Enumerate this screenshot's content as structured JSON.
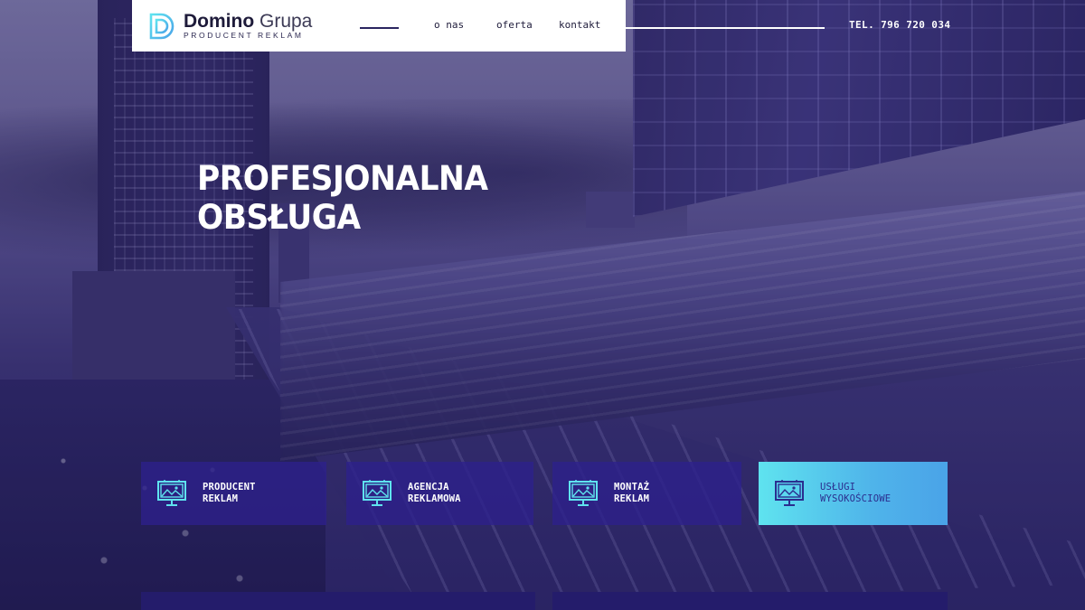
{
  "brand": {
    "name_bold": "Domino",
    "name_light": "Grupa",
    "tagline": "PRODUCENT REKLAM"
  },
  "nav": {
    "items": [
      {
        "label": "o nas"
      },
      {
        "label": "oferta"
      },
      {
        "label": "kontakt"
      }
    ]
  },
  "header": {
    "phone": "TEL. 796 720 034"
  },
  "hero": {
    "title_line1": "PROFESJONALNA",
    "title_line2": "OBSŁUGA"
  },
  "services": [
    {
      "line1": "PRODUCENT",
      "line2": "REKLAM",
      "icon": "billboard-icon"
    },
    {
      "line1": "AGENCJA",
      "line2": "REKLAMOWA",
      "icon": "billboard-icon"
    },
    {
      "line1": "MONTAŻ",
      "line2": "REKLAM",
      "icon": "billboard-icon"
    },
    {
      "line1": "USŁUGI",
      "line2": "WYSOKOŚCIOWE",
      "icon": "billboard-icon",
      "active": true
    }
  ],
  "colors": {
    "accent_cyan": "#5fe3ef",
    "accent_blue": "#4aa3e8",
    "tile_bg": "#2d208c",
    "dark_navy": "#1e1b3a"
  }
}
